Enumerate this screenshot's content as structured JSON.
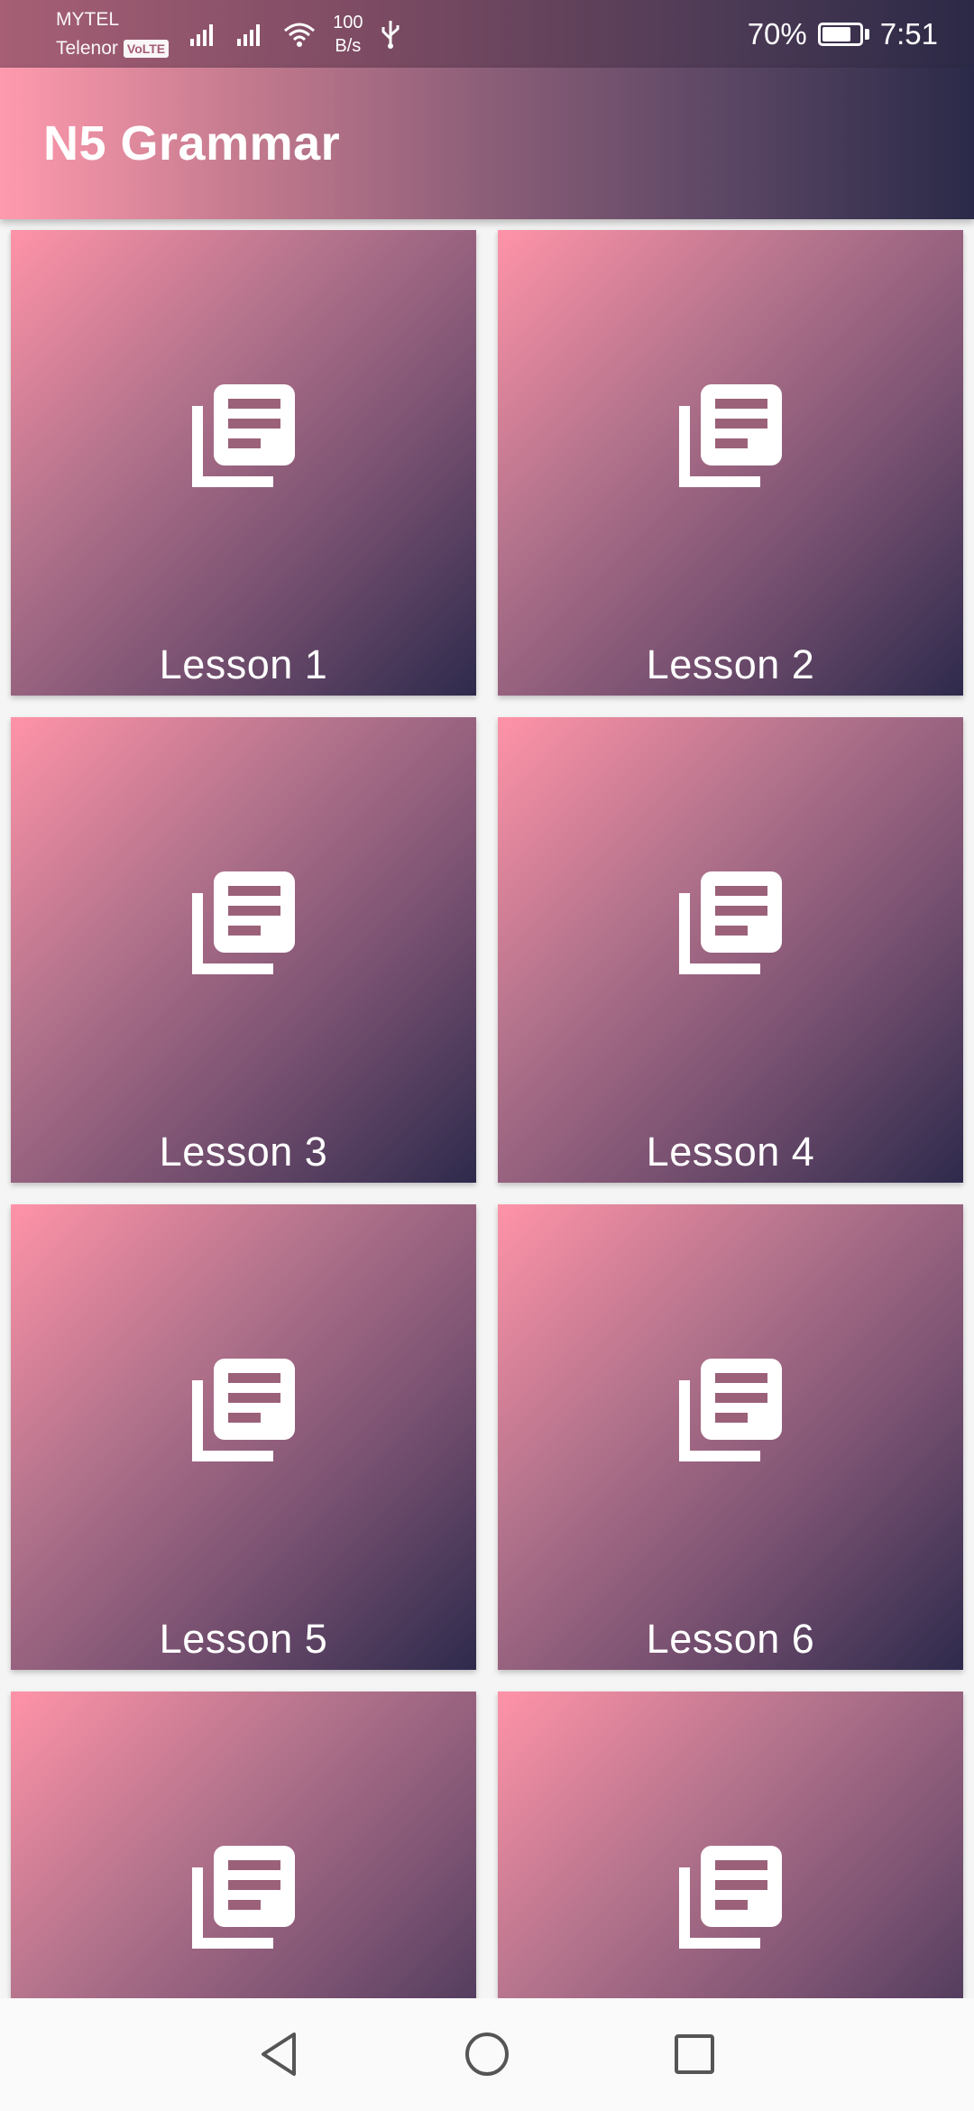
{
  "status_bar": {
    "carrier_1": "MYTEL",
    "carrier_2": "Telenor",
    "volte": "VoLTE",
    "speed_value": "100",
    "speed_unit": "B/s",
    "battery": "70%",
    "time": "7:51"
  },
  "app_bar": {
    "title": "N5 Grammar"
  },
  "lessons": [
    {
      "label": "Lesson 1",
      "icon": "library-books-icon"
    },
    {
      "label": "Lesson 2",
      "icon": "library-books-icon"
    },
    {
      "label": "Lesson 3",
      "icon": "library-books-icon"
    },
    {
      "label": "Lesson 4",
      "icon": "library-books-icon"
    },
    {
      "label": "Lesson 5",
      "icon": "library-books-icon"
    },
    {
      "label": "Lesson 6",
      "icon": "library-books-icon"
    },
    {
      "label": "",
      "icon": "library-books-icon"
    },
    {
      "label": "",
      "icon": "library-books-icon"
    }
  ],
  "nav_bar": {
    "back": "back-triangle-icon",
    "home": "home-circle-icon",
    "recents": "recents-square-icon"
  },
  "colors": {
    "gradient_start": "#ff93a8",
    "gradient_end": "#2e2a4c",
    "nav_icon": "#555555"
  }
}
